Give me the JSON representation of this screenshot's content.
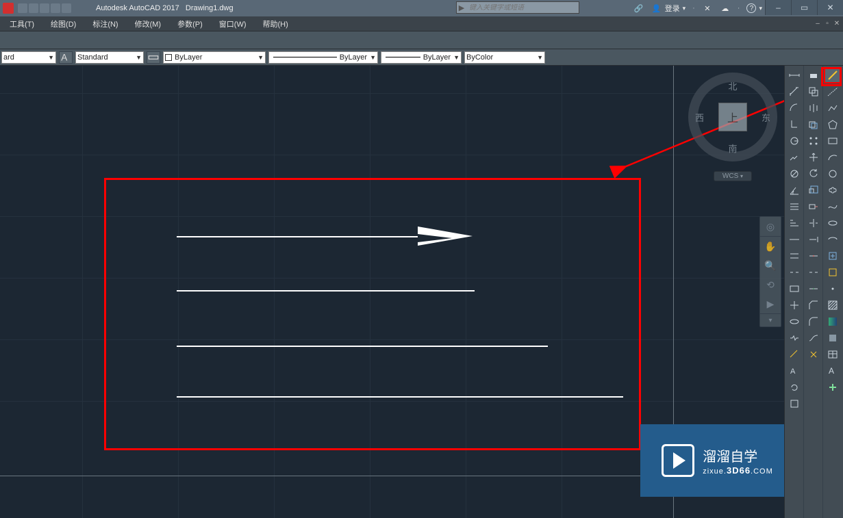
{
  "titlebar": {
    "app": "Autodesk AutoCAD 2017",
    "doc": "Drawing1.dwg",
    "search_placeholder": "键入关键字或短语",
    "login": "登录",
    "win_min": "–",
    "win_max": "▭",
    "win_close": "✕"
  },
  "menu": {
    "items": [
      "工具(T)",
      "绘图(D)",
      "标注(N)",
      "修改(M)",
      "参数(P)",
      "窗口(W)",
      "帮助(H)"
    ]
  },
  "props": {
    "style1": "ard",
    "style2": "Standard",
    "color": "ByLayer",
    "ltype": "ByLayer",
    "lweight": "ByLayer",
    "bycolor": "ByColor"
  },
  "viewcube": {
    "north": "北",
    "south": "南",
    "east": "东",
    "west": "西",
    "top": "上",
    "wcs": "WCS"
  },
  "watermark": {
    "line1": "溜溜自学",
    "line2a": "zixue.",
    "line2b": "3D66",
    "line2c": ".COM"
  }
}
